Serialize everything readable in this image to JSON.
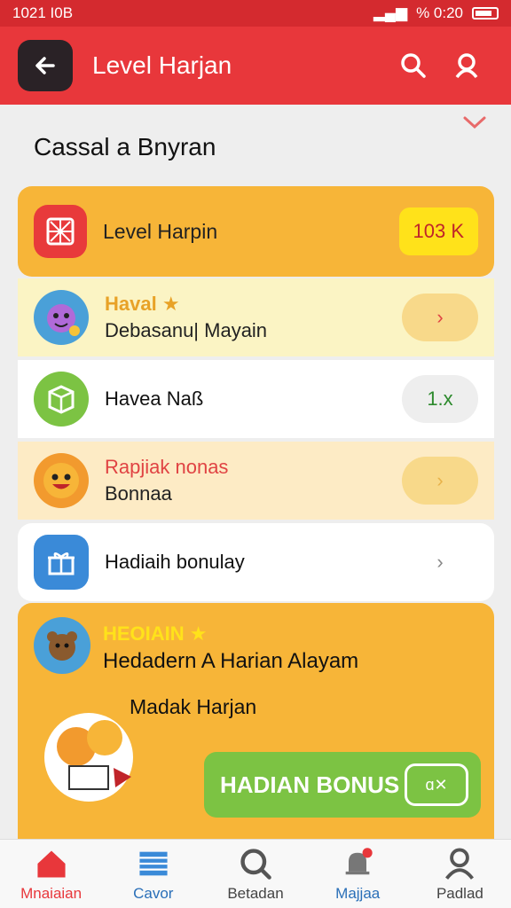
{
  "status_bar": {
    "time": "1021 I0B",
    "battery": "%  0:20"
  },
  "header": {
    "title": "Level Harjan"
  },
  "section": {
    "title": "Cassal a Bnyran"
  },
  "level_card": {
    "label": "Level Harpin",
    "count": "103 K"
  },
  "rows": [
    {
      "line1": "Haval ★",
      "line2": "Debasanu| Mayain",
      "action": "›",
      "color": "#e8a227"
    },
    {
      "line1": "Havea Naß",
      "line2": "",
      "action": "1.x",
      "color": "#2d8a2d"
    },
    {
      "line1": "Rapjiak nonas",
      "line2": "Bonnaa",
      "action": "›",
      "color": "#e04343"
    },
    {
      "line1": "Hadiaih bonulay",
      "line2": "",
      "action": "›",
      "color": "#111111"
    }
  ],
  "promo": {
    "tag": "HEOIAIN ★",
    "title": "Hedadern A Harian Alayam",
    "subtitle": "Madak Harjan",
    "button_label": "HADIAN BONUS"
  },
  "nav": [
    {
      "label": "Mnaiaian",
      "color": "#e8373b",
      "icon": "home-icon"
    },
    {
      "label": "Cavor",
      "color": "#2a6fb8",
      "icon": "flag-icon"
    },
    {
      "label": "Betadan",
      "color": "#444444",
      "icon": "search-icon"
    },
    {
      "label": "Majjaa",
      "color": "#2a6fb8",
      "icon": "bell-icon"
    },
    {
      "label": "Padlad",
      "color": "#444444",
      "icon": "profile-icon"
    }
  ],
  "colors": {
    "accent": "#e8373b",
    "card": "#f7b538",
    "bonus": "#7cc343"
  }
}
